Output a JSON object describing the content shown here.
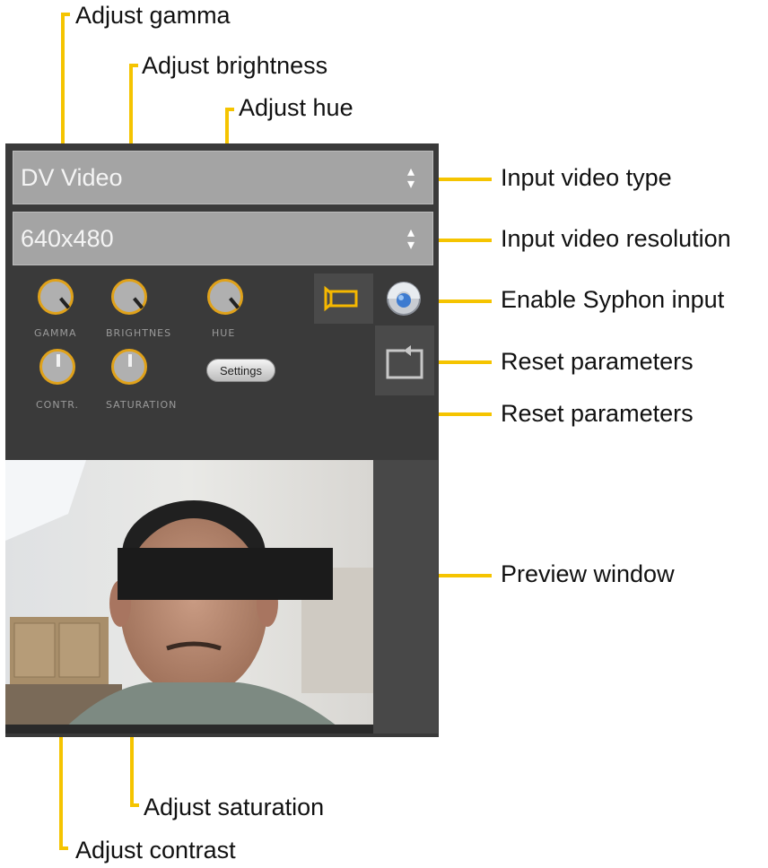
{
  "annotations": {
    "gamma": "Adjust gamma",
    "brightness": "Adjust brightness",
    "hue": "Adjust hue",
    "input_type": "Input video type",
    "input_resolution": "Input video resolution",
    "syphon": "Enable Syphon input",
    "reset_1": "Reset parameters",
    "reset_2": "Reset parameters",
    "preview": "Preview window",
    "saturation": "Adjust saturation",
    "contrast": "Adjust contrast"
  },
  "panel": {
    "input_type_value": "DV Video",
    "resolution_value": "640x480",
    "knobs": {
      "gamma_label": "GAMMA",
      "brightness_label": "BRIGHTNES",
      "hue_label": "HUE",
      "contrast_label": "CONTR.",
      "saturation_label": "SATURATION"
    },
    "settings_label": "Settings"
  },
  "colors": {
    "callout_line": "#f5c400",
    "panel_bg": "#3a3a3a",
    "knob_ring": "#e0a21a"
  },
  "icons": [
    "dropdown-arrows-icon",
    "camera-icon",
    "syphon-icon",
    "reset-icon"
  ]
}
